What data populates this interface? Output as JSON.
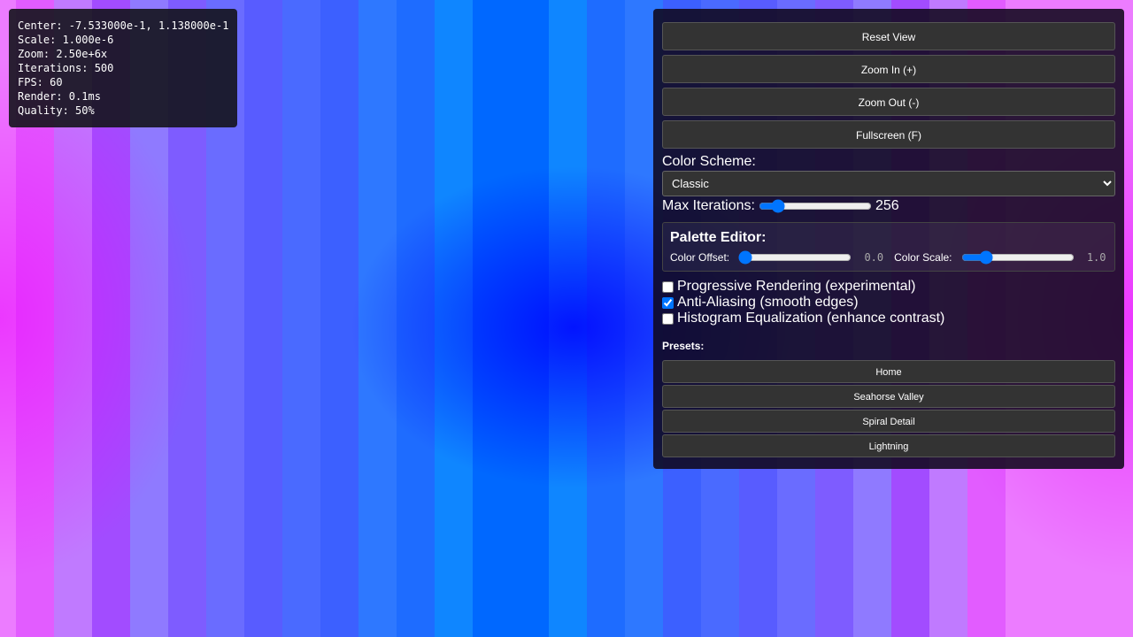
{
  "info": {
    "center": "Center: -7.533000e-1, 1.138000e-1",
    "scale": "Scale: 1.000e-6",
    "zoom": "Zoom: 2.50e+6x",
    "iterations": "Iterations: 500",
    "fps": "FPS: 60",
    "render": "Render: 0.1ms",
    "quality": "Quality: 50%"
  },
  "controls": {
    "reset_view": "Reset View",
    "zoom_in": "Zoom In (+)",
    "zoom_out": "Zoom Out (-)",
    "fullscreen": "Fullscreen (F)",
    "color_scheme_label": "Color Scheme:",
    "color_scheme_selected": "Classic",
    "max_iterations_label": "Max Iterations:",
    "max_iterations_value": "256",
    "max_iterations_num": 256
  },
  "palette": {
    "title": "Palette Editor:",
    "offset_label": "Color Offset:",
    "offset_value": "0.0",
    "offset_num": 0,
    "scale_label": "Color Scale:",
    "scale_value": "1.0",
    "scale_num": 1.0
  },
  "options": {
    "progressive": {
      "label": "Progressive Rendering (experimental)",
      "checked": false
    },
    "antialias": {
      "label": "Anti-Aliasing (smooth edges)",
      "checked": true
    },
    "histogram": {
      "label": "Histogram Equalization (enhance contrast)",
      "checked": false
    }
  },
  "presets": {
    "label": "Presets:",
    "items": [
      "Home",
      "Seahorse Valley",
      "Spiral Detail",
      "Lightning"
    ]
  },
  "canvas_colors": [
    "#ec7cff",
    "#e25cff",
    "#c07aff",
    "#a24cff",
    "#8f7aff",
    "#7e5cff",
    "#6a6cff",
    "#585cff",
    "#4a6aff",
    "#3c60ff",
    "#2e78ff",
    "#1e6cff",
    "#0f86ff",
    "#0068ff"
  ]
}
